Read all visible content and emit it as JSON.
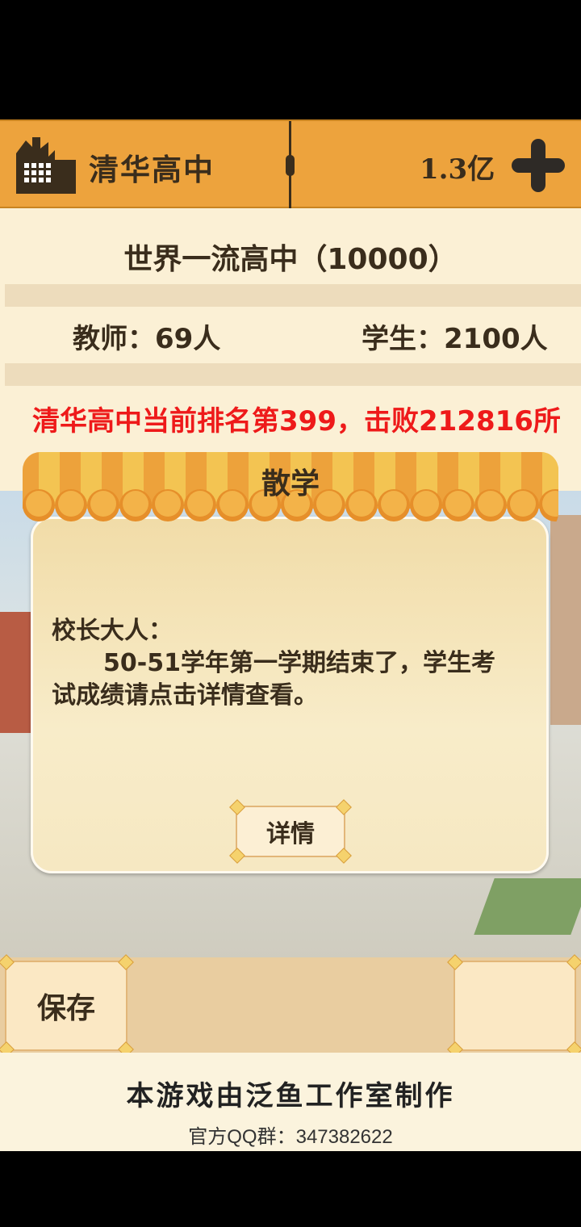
{
  "header": {
    "school_name": "清华高中",
    "money": "1.3亿"
  },
  "info": {
    "rank_title": "世界一流高中（10000）",
    "teachers": "教师：69人",
    "students": "学生：2100人",
    "ranking": "清华高中当前排名第399，击败212816所"
  },
  "dialog": {
    "title": "散学",
    "greeting": "校长大人：",
    "body_line1": "50-51学年第一学期结束了，学生考",
    "body_line2": "试成绩请点击详情查看。",
    "detail_button": "详情"
  },
  "bottom": {
    "save_button": "保存"
  },
  "footer": {
    "credit": "本游戏由泛鱼工作室制作",
    "qq": "官方QQ群：347382622"
  },
  "colors": {
    "topbar": "#eda33d",
    "ranking_text": "#ee1a1a",
    "panel": "#fbf0d5"
  }
}
